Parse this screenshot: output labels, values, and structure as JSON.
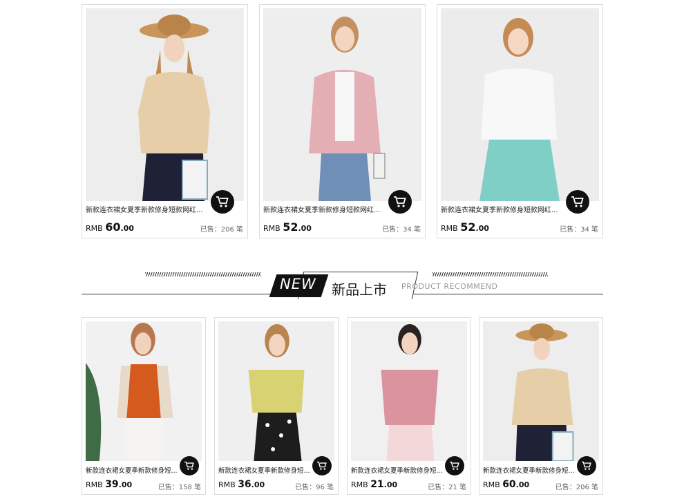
{
  "colors": {
    "accent": "#111111",
    "border": "#dcdcdc",
    "muted": "#666666"
  },
  "section": {
    "new_badge": "NEW",
    "title": "新品上市",
    "subtitle": "PRODUCT RECOMMEND"
  },
  "products_top": [
    {
      "title": "新款连衣裙女夏季新款修身短款网红...",
      "currency": "RMB",
      "price_int": "60",
      "price_dec": ".00",
      "sold": "已售：206 笔",
      "icon": "cart-icon"
    },
    {
      "title": "新款连衣裙女夏季新款修身短款网红...",
      "currency": "RMB",
      "price_int": "52",
      "price_dec": ".00",
      "sold": "已售：34 笔",
      "icon": "cart-icon"
    },
    {
      "title": "新款连衣裙女夏季新款修身短款网红...",
      "currency": "RMB",
      "price_int": "52",
      "price_dec": ".00",
      "sold": "已售：34 笔",
      "icon": "cart-icon"
    }
  ],
  "products_bottom": [
    {
      "title": "新款连衣裙女夏季新款修身短...",
      "currency": "RMB",
      "price_int": "39",
      "price_dec": ".00",
      "sold": "已售：158 笔",
      "icon": "cart-icon"
    },
    {
      "title": "新款连衣裙女夏季新款修身短...",
      "currency": "RMB",
      "price_int": "36",
      "price_dec": ".00",
      "sold": "已售：96 笔",
      "icon": "cart-icon"
    },
    {
      "title": "新款连衣裙女夏季新款修身短...",
      "currency": "RMB",
      "price_int": "21",
      "price_dec": ".00",
      "sold": "已售：21 笔",
      "icon": "cart-icon"
    },
    {
      "title": "新款连衣裙女夏季新款修身短...",
      "currency": "RMB",
      "price_int": "60",
      "price_dec": ".00",
      "sold": "已售：206 笔",
      "icon": "cart-icon"
    }
  ]
}
